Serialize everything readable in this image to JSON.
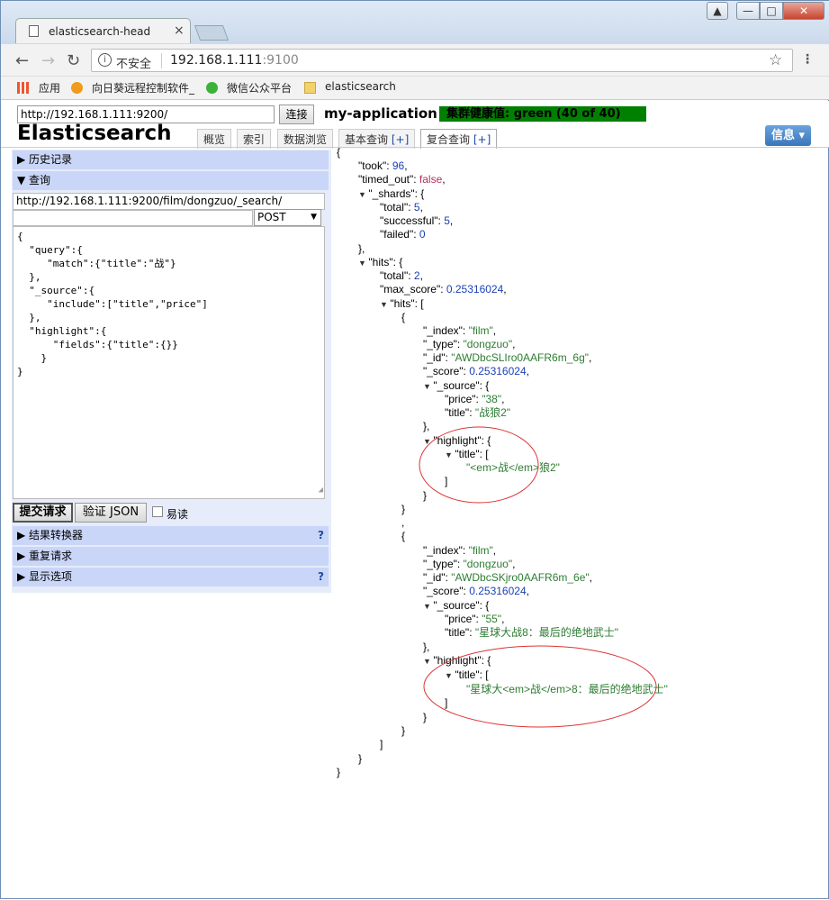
{
  "browser": {
    "tab_title": "elasticsearch-head",
    "insecure_label": "不安全",
    "url_host": "192.168.1.111",
    "url_port": ":9100",
    "bookmarks": [
      "应用",
      "向日葵远程控制软件_",
      "微信公众平台",
      "elasticsearch"
    ],
    "win_buttons": [
      "▲",
      "—",
      "□",
      "✕"
    ]
  },
  "header": {
    "connect_url": "http://192.168.1.111:9200/",
    "connect_button": "连接",
    "cluster_name": "my-application",
    "health": "集群健康值: green (40 of 40)",
    "brand": "Elasticsearch",
    "tabs": [
      {
        "label": "概览",
        "plus": ""
      },
      {
        "label": "索引",
        "plus": ""
      },
      {
        "label": "数据浏览",
        "plus": ""
      },
      {
        "label": "基本查询 ",
        "plus": "[+]"
      },
      {
        "label": "复合查询 ",
        "plus": "[+]"
      }
    ],
    "info_button": "信息 ▾"
  },
  "left": {
    "history": "▶ 历史记录",
    "query": "▼ 查询",
    "path": "http://192.168.1.111:9200/film/dongzuo/_search/",
    "method": "POST",
    "body": "{\n  \"query\":{\n     \"match\":{\"title\":\"战\"}\n  },\n  \"_source\":{\n     \"include\":[\"title\",\"price\"]\n  },\n  \"highlight\":{\n      \"fields\":{\"title\":{}}\n    }\n}",
    "submit": "提交请求",
    "validate": "验证 JSON",
    "pretty": "易读",
    "transformer": "▶ 结果转换器",
    "repeat": "▶ 重复请求",
    "display": "▶ 显示选项",
    "help": "?"
  },
  "result": {
    "took": "96",
    "timed_out": "false",
    "shards": {
      "total": "5",
      "successful": "5",
      "failed": "0"
    },
    "total": "2",
    "max_score": "0.25316024",
    "hits": [
      {
        "index": "\"film\"",
        "type": "\"dongzuo\"",
        "id": "\"AWDbcSLIro0AAFR6m_6g\"",
        "score": "0.25316024",
        "price": "\"38\"",
        "title": "\"战狼2\"",
        "hl": "\"<em>战</em>狼2\""
      },
      {
        "index": "\"film\"",
        "type": "\"dongzuo\"",
        "id": "\"AWDbcSKjro0AAFR6m_6e\"",
        "score": "0.25316024",
        "price": "\"55\"",
        "title": "\"星球大战8：最后的绝地武士\"",
        "hl": "\"星球大<em>战</em>8：最后的绝地武士\""
      }
    ]
  },
  "colors": {
    "health": "#008000",
    "string": "#2e7d32",
    "number": "#1a3fb4",
    "bool": "#b03060",
    "annot": "#d33"
  }
}
